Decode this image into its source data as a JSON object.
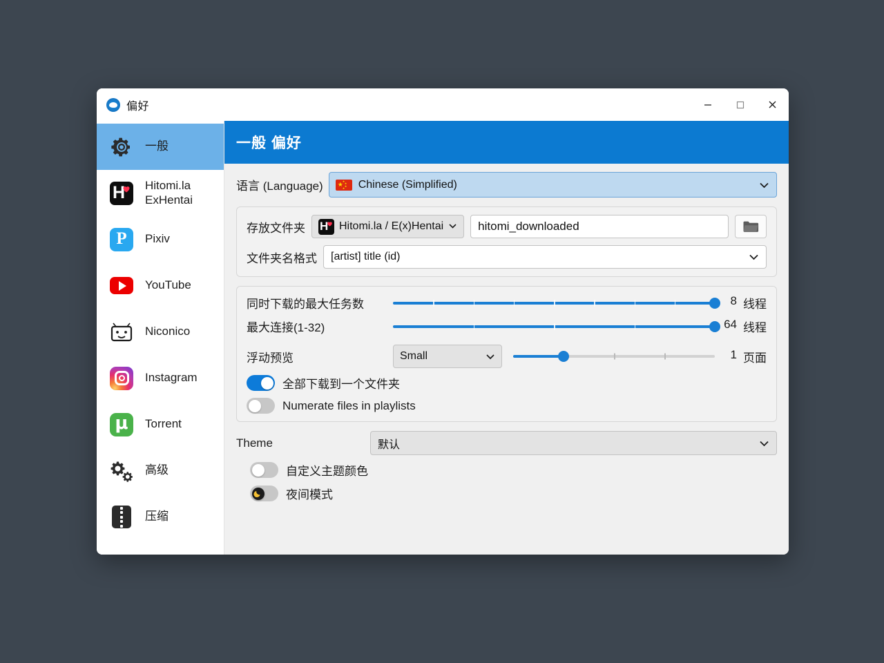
{
  "window": {
    "title": "偏好",
    "app_icon": "app-logo-icon",
    "controls": {
      "minimize": "minimize-icon",
      "maximize": "maximize-icon",
      "close": "close-icon"
    }
  },
  "sidebar": {
    "items": [
      {
        "label": "一般",
        "icon": "gear-icon",
        "selected": true
      },
      {
        "label": "Hitomi.la\nExHentai",
        "icon": "hitomi-icon",
        "selected": false
      },
      {
        "label": "Pixiv",
        "icon": "pixiv-icon",
        "selected": false
      },
      {
        "label": "YouTube",
        "icon": "youtube-icon",
        "selected": false
      },
      {
        "label": "Niconico",
        "icon": "niconico-icon",
        "selected": false
      },
      {
        "label": "Instagram",
        "icon": "instagram-icon",
        "selected": false
      },
      {
        "label": "Torrent",
        "icon": "torrent-icon",
        "selected": false
      },
      {
        "label": "高级",
        "icon": "gears-icon",
        "selected": false
      },
      {
        "label": "压缩",
        "icon": "archive-icon",
        "selected": false
      }
    ]
  },
  "main": {
    "header": "一般 偏好",
    "language": {
      "label": "语言 (Language)",
      "value": "Chinese (Simplified)",
      "flag": "flag-cn-icon"
    },
    "storage": {
      "label": "存放文件夹",
      "site_value": "Hitomi.la / E(x)Hentai",
      "path_value": "hitomi_downloaded",
      "path_placeholder": "hitomi_downloaded",
      "browse_icon": "folder-icon"
    },
    "folder_format": {
      "label": "文件夹名格式",
      "value": "[artist] title (id)"
    },
    "sliders": {
      "max_tasks": {
        "label": "同时下载的最大任务数",
        "value": "8",
        "unit": "线程",
        "percent": 100,
        "ticks": 7
      },
      "max_connections": {
        "label": "最大连接(1-32)",
        "value": "64",
        "unit": "线程",
        "percent": 100,
        "ticks": 3
      },
      "float_preview": {
        "label": "浮动预览",
        "size_value": "Small",
        "value": "1",
        "unit": "页面",
        "percent": 25,
        "ticks": 3
      }
    },
    "toggles": [
      {
        "label": "全部下载到一个文件夹",
        "on": true,
        "icon": "toggle-icon"
      },
      {
        "label": "Numerate files in playlists",
        "on": false,
        "icon": "toggle-icon"
      }
    ],
    "theme": {
      "label": "Theme",
      "value": "默认",
      "toggles": [
        {
          "label": "自定义主题颜色",
          "on": false,
          "icon": "toggle-icon"
        },
        {
          "label": "夜间模式",
          "on": false,
          "icon": "moon-toggle-icon"
        }
      ]
    }
  },
  "colors": {
    "accent": "#0c7ad1",
    "slider": "#1a7fd4",
    "selection": "#6cb1e8",
    "desktop": "#3d4650"
  }
}
